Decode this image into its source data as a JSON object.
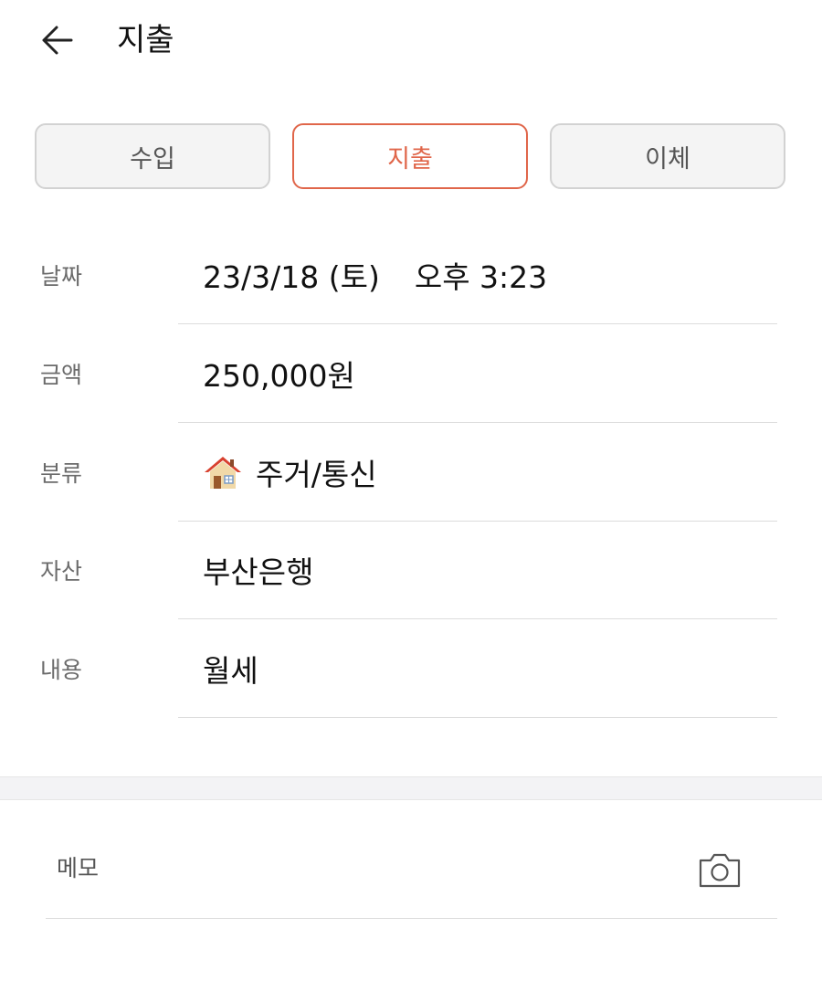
{
  "header": {
    "back_icon": "arrow-left-icon",
    "title": "지출"
  },
  "tabs": [
    {
      "label": "수입",
      "active": false
    },
    {
      "label": "지출",
      "active": true
    },
    {
      "label": "이체",
      "active": false
    }
  ],
  "colors": {
    "accent": "#e0664a",
    "label": "#6b6b6b",
    "divider": "#dcdcdc"
  },
  "fields": {
    "date": {
      "label": "날짜",
      "date": "23/3/18 (토)",
      "time": "오후 3:23"
    },
    "amount": {
      "label": "금액",
      "value": "250,000원"
    },
    "category": {
      "label": "분류",
      "icon": "house-icon",
      "value": "주거/통신"
    },
    "asset": {
      "label": "자산",
      "value": "부산은행"
    },
    "content": {
      "label": "내용",
      "value": "월세"
    }
  },
  "memo": {
    "label": "메모",
    "camera_icon": "camera-icon"
  }
}
